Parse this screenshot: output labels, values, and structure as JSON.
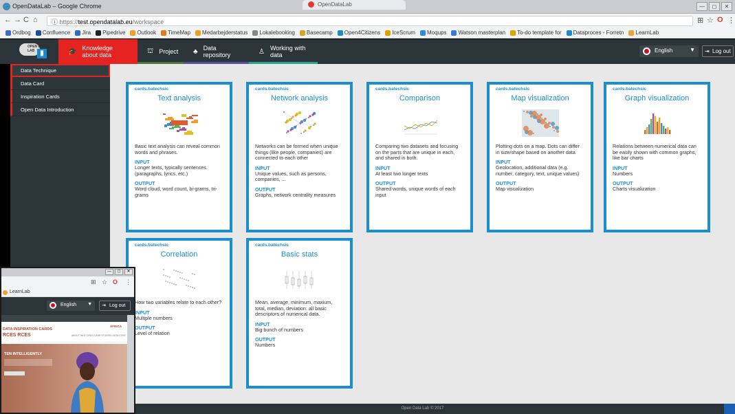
{
  "browser": {
    "window_title": "OpenDataLab – Google Chrome",
    "tab_title": "OpenDataLab",
    "url_scheme": "https://",
    "url_host": "test.opendatalab.eu",
    "url_path": "/workspace",
    "nav_back": "←",
    "nav_forward": "→",
    "nav_reload": "C",
    "nav_home": "⌂",
    "info_icon": "ⓘ",
    "star_icon": "☆",
    "menu_icon": "⋮",
    "opera_icon": "O",
    "translate_icon": "⊞",
    "win_min": "—",
    "win_max": "◻",
    "win_close": "✕",
    "bookmarks": [
      {
        "label": "Ordbog",
        "color": "#3b6dc2"
      },
      {
        "label": "Confluence",
        "color": "#1f4f9c"
      },
      {
        "label": "Jira",
        "color": "#2d6cc8"
      },
      {
        "label": "Pipedrive",
        "color": "#222222"
      },
      {
        "label": "Outlook",
        "color": "#f0a020"
      },
      {
        "label": "TimeMap",
        "color": "#e07a1a"
      },
      {
        "label": "Medarbejderstatus",
        "color": "#f0a020"
      },
      {
        "label": "Lokalebooking",
        "color": "#888888"
      },
      {
        "label": "Basecamp",
        "color": "#d9a324"
      },
      {
        "label": "Open4Citizens",
        "color": "#1e88c8"
      },
      {
        "label": "IceScrum",
        "color": "#e0a000"
      },
      {
        "label": "Moqups",
        "color": "#2f8adb"
      },
      {
        "label": "Watson masterplan",
        "color": "#3979d6"
      },
      {
        "label": "To-do template for",
        "color": "#e0a000"
      },
      {
        "label": "Dataproces - Forretn",
        "color": "#1e88c8"
      },
      {
        "label": "LearnLab",
        "color": "#e8a33d"
      }
    ]
  },
  "appnav": {
    "logo_text": "OPEN DATA LAB",
    "tabs": [
      {
        "label": "Knowledge about data",
        "icon": "🎓",
        "active": true,
        "underline": "#e52421"
      },
      {
        "label": "Project",
        "icon": "⛫",
        "active": false,
        "underline": "#4a7a3a"
      },
      {
        "label": "Data repository",
        "icon": "♣",
        "active": false,
        "underline": "#5a4fa0"
      },
      {
        "label": "Working with data",
        "icon": "♙",
        "active": false,
        "underline": "#2aa58a"
      }
    ],
    "language": "English",
    "language_caret": "▼",
    "logout_label": "Log out",
    "logout_icon": "⇥"
  },
  "sidebar": {
    "items": [
      {
        "label": "Data Technique",
        "selected": true
      },
      {
        "label": "Data Card",
        "selected": false
      },
      {
        "label": "Inspiration Cards",
        "selected": false
      },
      {
        "label": "Open Data Introduction",
        "selected": false
      }
    ]
  },
  "cards": [
    {
      "category": "cards.batechsic",
      "title": "Text analysis",
      "thumb": "wordcloud-image",
      "description": "Basic text analysis can reveal common words and phrases.",
      "input_label": "INPUT",
      "input": "Longer texts, typically sentences. (paragraphs, lyrics, etc.)",
      "output_label": "OUTPUT",
      "output": "Word cloud, word count, bi-grams, tri-grams"
    },
    {
      "category": "cards.batechsic",
      "title": "Network analysis",
      "thumb": "network-graph-image",
      "description": "Networks can be formed when unique things (like people, companies) are connected to each other",
      "input_label": "INPUT",
      "input": "Unique values, such as persons, companies, ...",
      "output_label": "OUTPUT",
      "output": "Graphs, network centrality measures"
    },
    {
      "category": "cards.batechsic",
      "title": "Comparison",
      "thumb": "line-chart-image",
      "description": "Comparing two datasets and focusing on the parts that are unique in each, and shared in both.",
      "input_label": "INPUT",
      "input": "At least two longer texts",
      "output_label": "OUTPUT",
      "output": "Shared words, unique words of each input"
    },
    {
      "category": "cards.batechsic",
      "title": "Map visualization",
      "thumb": "dot-map-image",
      "description": "Plotting dots on a map. Dots can differ in size/shape based on another data",
      "input_label": "INPUT",
      "input": "Geolocation, additional data (e.g. number, category, text, unique values)",
      "output_label": "OUTPUT",
      "output": "Map visualization"
    },
    {
      "category": "cards.batechsic",
      "title": "Graph visualization",
      "thumb": "bar-chart-image",
      "description": "Relations between numerical data can be easily shown with common graphs, like bar charts",
      "input_label": "INPUT",
      "input": "Numbers",
      "output_label": "OUTPUT",
      "output": "Charts visualization"
    },
    {
      "category": "cards.batechsic",
      "title": "Correlation",
      "thumb": "scatter-plot-image",
      "description": "How two variables relate to each other?",
      "input_label": "INPUT",
      "input": "Multiple numbers",
      "output_label": "OUTPUT",
      "output": "Level of relation"
    },
    {
      "category": "cards.batechsic",
      "title": "Basic stats",
      "thumb": "box-plot-image",
      "description": "Mean, average, minimum, maxium, total, median, deviation: all basic descriptors of numerical data.",
      "input_label": "INPUT",
      "input": "Big bunch of numbers",
      "output_label": "OUTPUT",
      "output": "Numbers"
    }
  ],
  "footer": {
    "text": "Open Data Lab © 2017"
  },
  "second_window": {
    "bookmark": "LearnLab",
    "language": "English",
    "logout_label": "Log out",
    "brand_small": "DATA INSPIRATION CARDS",
    "brand_large": "RCES RCES",
    "region": "AFRICA",
    "menu_text": "ABOUT  WHY OPEN  CASE STUDIES  DATA  CONT",
    "hero_text": "TEN INTELLIGENTLY"
  }
}
